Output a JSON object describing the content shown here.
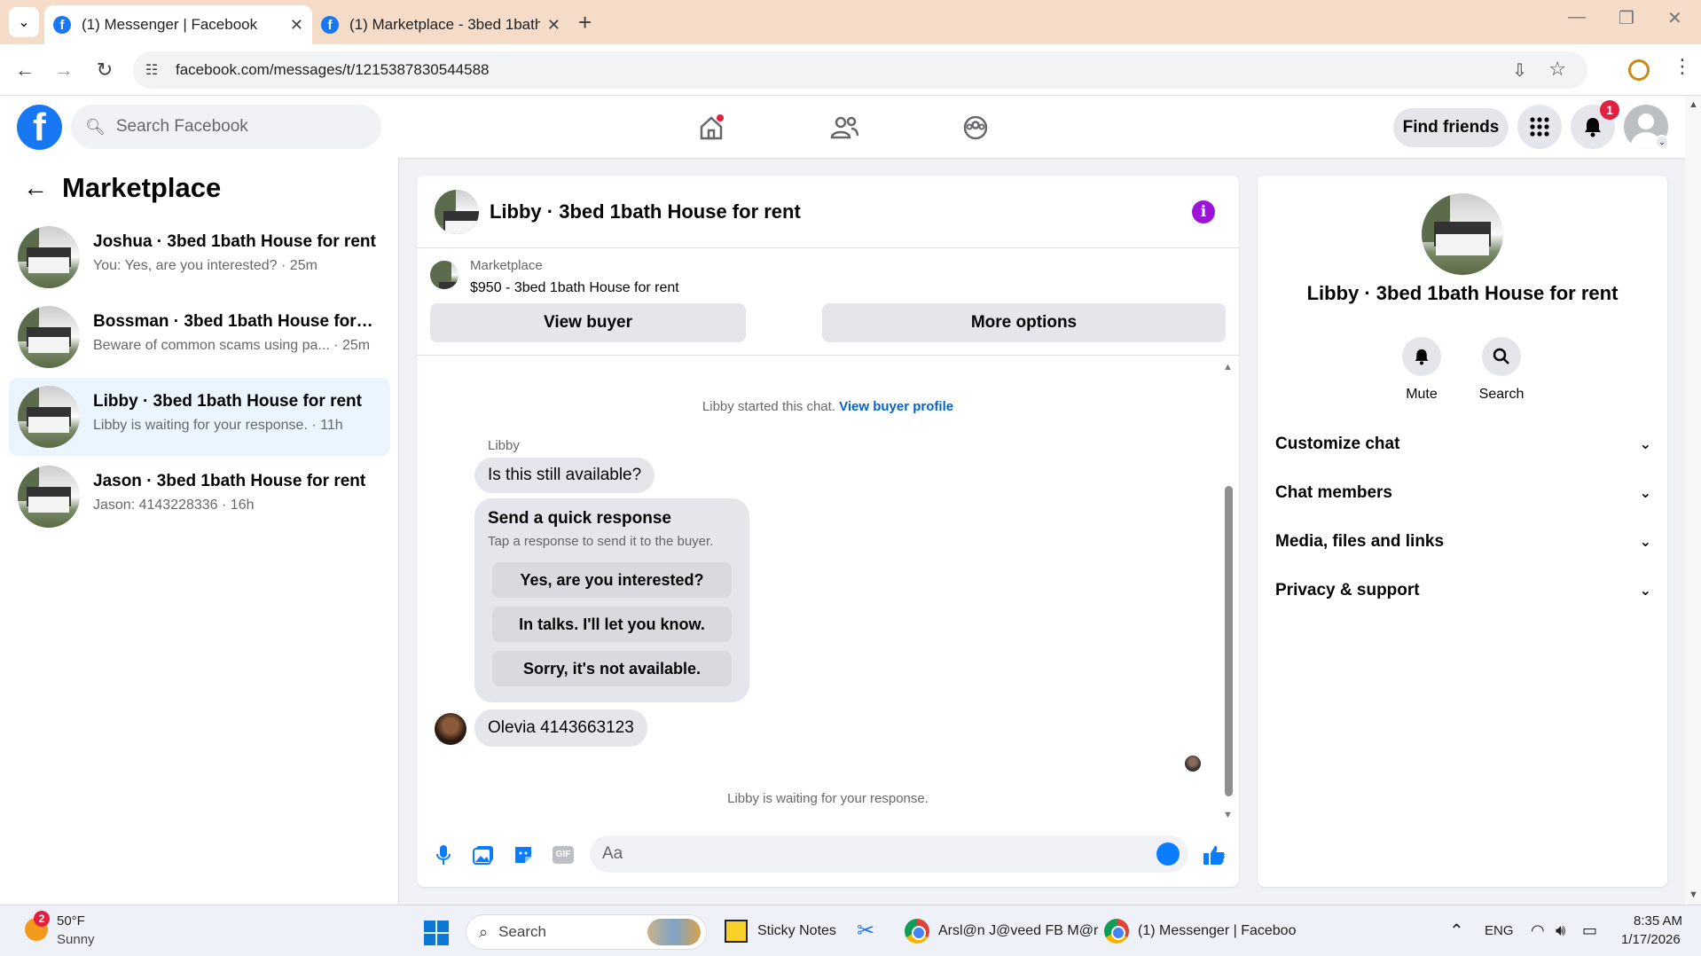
{
  "browser": {
    "tabs": [
      {
        "title": "(1) Messenger | Facebook",
        "active": true
      },
      {
        "title": "(1) Marketplace - 3bed 1bath H",
        "active": false
      }
    ],
    "url": "facebook.com/messages/t/1215387830544588"
  },
  "fb_header": {
    "search_placeholder": "Search Facebook",
    "find_friends_label": "Find friends",
    "notification_count": "1"
  },
  "left_panel": {
    "title": "Marketplace",
    "conversations": [
      {
        "name": "Joshua · 3bed 1bath House for rent",
        "preview": "You: Yes, are you interested? · 25m",
        "selected": false
      },
      {
        "name": "Bossman · 3bed 1bath House for r...",
        "preview": "Beware of common scams using pa... · 25m",
        "selected": false
      },
      {
        "name": "Libby · 3bed 1bath House for rent",
        "preview": "Libby is waiting for your response. · 11h",
        "selected": true
      },
      {
        "name": "Jason · 3bed 1bath House for rent",
        "preview": "Jason: 4143228336 · 16h",
        "selected": false
      }
    ]
  },
  "chat": {
    "title": "Libby · 3bed 1bath House for rent",
    "listing_source": "Marketplace",
    "listing": "$950 - 3bed 1bath House for rent",
    "view_buyer_label": "View buyer",
    "more_options_label": "More options",
    "started_text": "Libby started this chat.",
    "view_profile_link": "View buyer profile",
    "sender_name": "Libby",
    "first_message": "Is this still available?",
    "quick_response": {
      "heading": "Send a quick response",
      "subheading": "Tap a response to send it to the buyer.",
      "options": [
        "Yes, are you interested?",
        "In talks. I'll let you know.",
        "Sorry, it's not available."
      ]
    },
    "second_message": "Olevia 4143663123",
    "waiting_text": "Libby is waiting for your response.",
    "composer_placeholder": "Aa"
  },
  "right_panel": {
    "title": "Libby · 3bed 1bath House for rent",
    "actions": [
      "Mute",
      "Search"
    ],
    "sections": [
      "Customize chat",
      "Chat members",
      "Media, files and links",
      "Privacy & support"
    ]
  },
  "taskbar": {
    "weather_temp": "50°F",
    "weather_desc": "Sunny",
    "weather_badge": "2",
    "search_label": "Search",
    "apps": [
      "Sticky Notes",
      "Arsl@n J@veed FB M@r",
      "(1) Messenger | Faceboo"
    ],
    "language": "ENG",
    "time": "8:35 AM",
    "date": "1/17/2026"
  },
  "colors": {
    "fb_blue": "#1877f2",
    "link_blue": "#0064d1",
    "selected_bg": "#ebf5ff",
    "info_purple": "#9b14d8"
  }
}
